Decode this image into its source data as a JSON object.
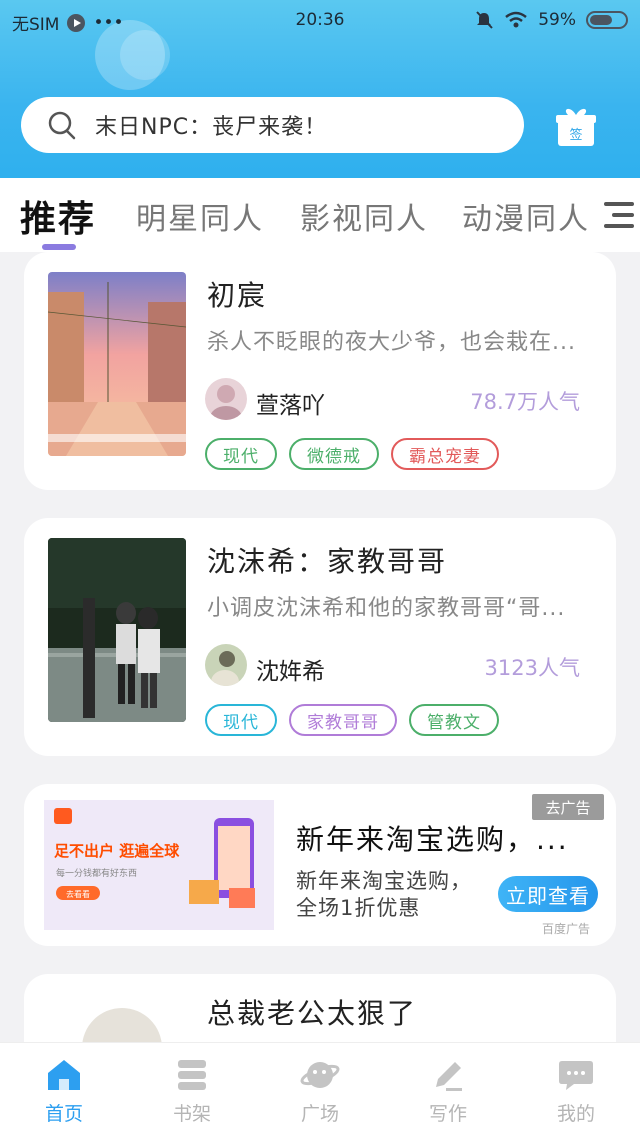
{
  "status_bar": {
    "carrier": "无SIM",
    "dots": "•••",
    "time": "20:36",
    "battery": "59%"
  },
  "search": {
    "placeholder": "末日NPC：丧尸来袭！"
  },
  "tabs": [
    {
      "label": "推荐",
      "active": true
    },
    {
      "label": "明星同人"
    },
    {
      "label": "影视同人"
    },
    {
      "label": "动漫同人"
    }
  ],
  "books": [
    {
      "title": "初宸",
      "desc": "杀人不眨眼的夜大少爷，也会栽在...",
      "author": "萱落吖",
      "popularity": "78.7万人气",
      "tags": [
        {
          "label": "现代",
          "color": "#4caf6a"
        },
        {
          "label": "微德戒",
          "color": "#4caf6a"
        },
        {
          "label": "霸总宠妻",
          "color": "#e25a5a"
        }
      ]
    },
    {
      "title": "沈沫希：家教哥哥",
      "desc": "小调皮沈沫希和他的家教哥哥“哥...",
      "author": "沈姩希",
      "popularity": "3123人气",
      "tags": [
        {
          "label": "现代",
          "color": "#29b6d8"
        },
        {
          "label": "家教哥哥",
          "color": "#b07cd8"
        },
        {
          "label": "管教文",
          "color": "#4caf6a"
        }
      ]
    },
    {
      "title": "总裁老公太狠了"
    }
  ],
  "ad": {
    "title": "新年来淘宝选购，...",
    "desc": "新年来淘宝选购，全场1折优惠",
    "cta": "立即查看",
    "ad_label": "去广告",
    "source": "百度广告",
    "image_text": {
      "headline": "足不出户 逛遍全球",
      "sub": "每一分钱都有好东西",
      "btn": "去看看"
    }
  },
  "bottom_nav": [
    {
      "label": "首页",
      "icon": "home-icon",
      "active": true
    },
    {
      "label": "书架",
      "icon": "bookshelf-icon"
    },
    {
      "label": "广场",
      "icon": "planet-icon"
    },
    {
      "label": "写作",
      "icon": "pen-icon"
    },
    {
      "label": "我的",
      "icon": "chat-bubble-icon"
    }
  ],
  "colors": {
    "header": "#3ab4ef",
    "accent": "#2d9ff0",
    "tab_underline": "#8b7be0",
    "popularity": "#b39ddb"
  }
}
